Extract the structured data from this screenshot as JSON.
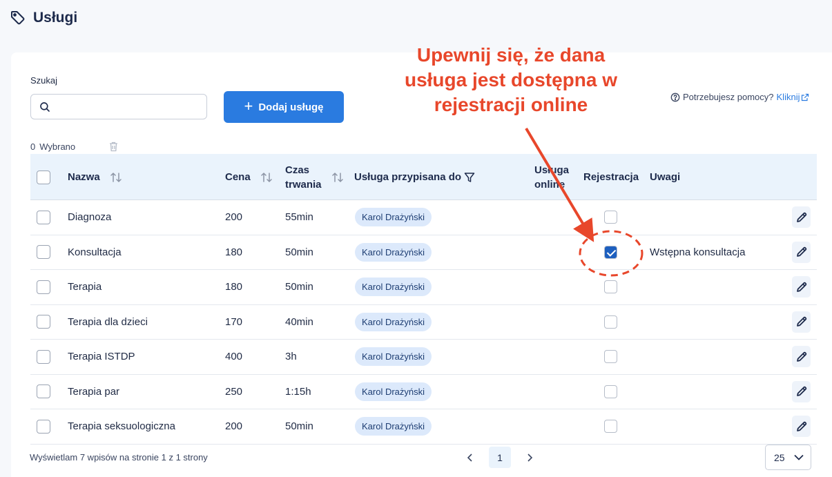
{
  "header": {
    "title": "Usługi",
    "icon": "tag-icon"
  },
  "search": {
    "label": "Szukaj",
    "value": "",
    "placeholder": ""
  },
  "add_button": {
    "label": "Dodaj usługę"
  },
  "help": {
    "text": "Potrzebujesz pomocy?",
    "link": "Kliknij"
  },
  "selection": {
    "count": "0",
    "label": "Wybrano"
  },
  "table": {
    "columns": {
      "name": "Nazwa",
      "price": "Cena",
      "duration": "Czas trwania",
      "assigned": "Usługa przypisana do",
      "online": "Usługa online",
      "registration": "Rejestracja",
      "notes": "Uwagi"
    },
    "rows": [
      {
        "name": "Diagnoza",
        "price": "200",
        "duration": "55min",
        "assigned": "Karol Drażyński",
        "registration": false,
        "notes": ""
      },
      {
        "name": "Konsultacja",
        "price": "180",
        "duration": "50min",
        "assigned": "Karol Drażyński",
        "registration": true,
        "notes": "Wstępna konsultacja"
      },
      {
        "name": "Terapia",
        "price": "180",
        "duration": "50min",
        "assigned": "Karol Drażyński",
        "registration": false,
        "notes": ""
      },
      {
        "name": "Terapia dla dzieci",
        "price": "170",
        "duration": "40min",
        "assigned": "Karol Drażyński",
        "registration": false,
        "notes": ""
      },
      {
        "name": "Terapia ISTDP",
        "price": "400",
        "duration": "3h",
        "assigned": "Karol Drażyński",
        "registration": false,
        "notes": ""
      },
      {
        "name": "Terapia par",
        "price": "250",
        "duration": "1:15h",
        "assigned": "Karol Drażyński",
        "registration": false,
        "notes": ""
      },
      {
        "name": "Terapia seksuologiczna",
        "price": "200",
        "duration": "50min",
        "assigned": "Karol Drażyński",
        "registration": false,
        "notes": ""
      }
    ]
  },
  "footer": {
    "summary": "Wyświetlam 7 wpisów na stronie 1 z 1 strony",
    "current_page": "1",
    "page_size": "25"
  },
  "annotation": {
    "text": "Upewnij się, że dana usługa jest dostępna w rejestracji online",
    "color": "#e8472b"
  },
  "colors": {
    "accent": "#2a7be0",
    "header_bg": "#eaf3fc",
    "pill_bg": "#dce9fb"
  }
}
